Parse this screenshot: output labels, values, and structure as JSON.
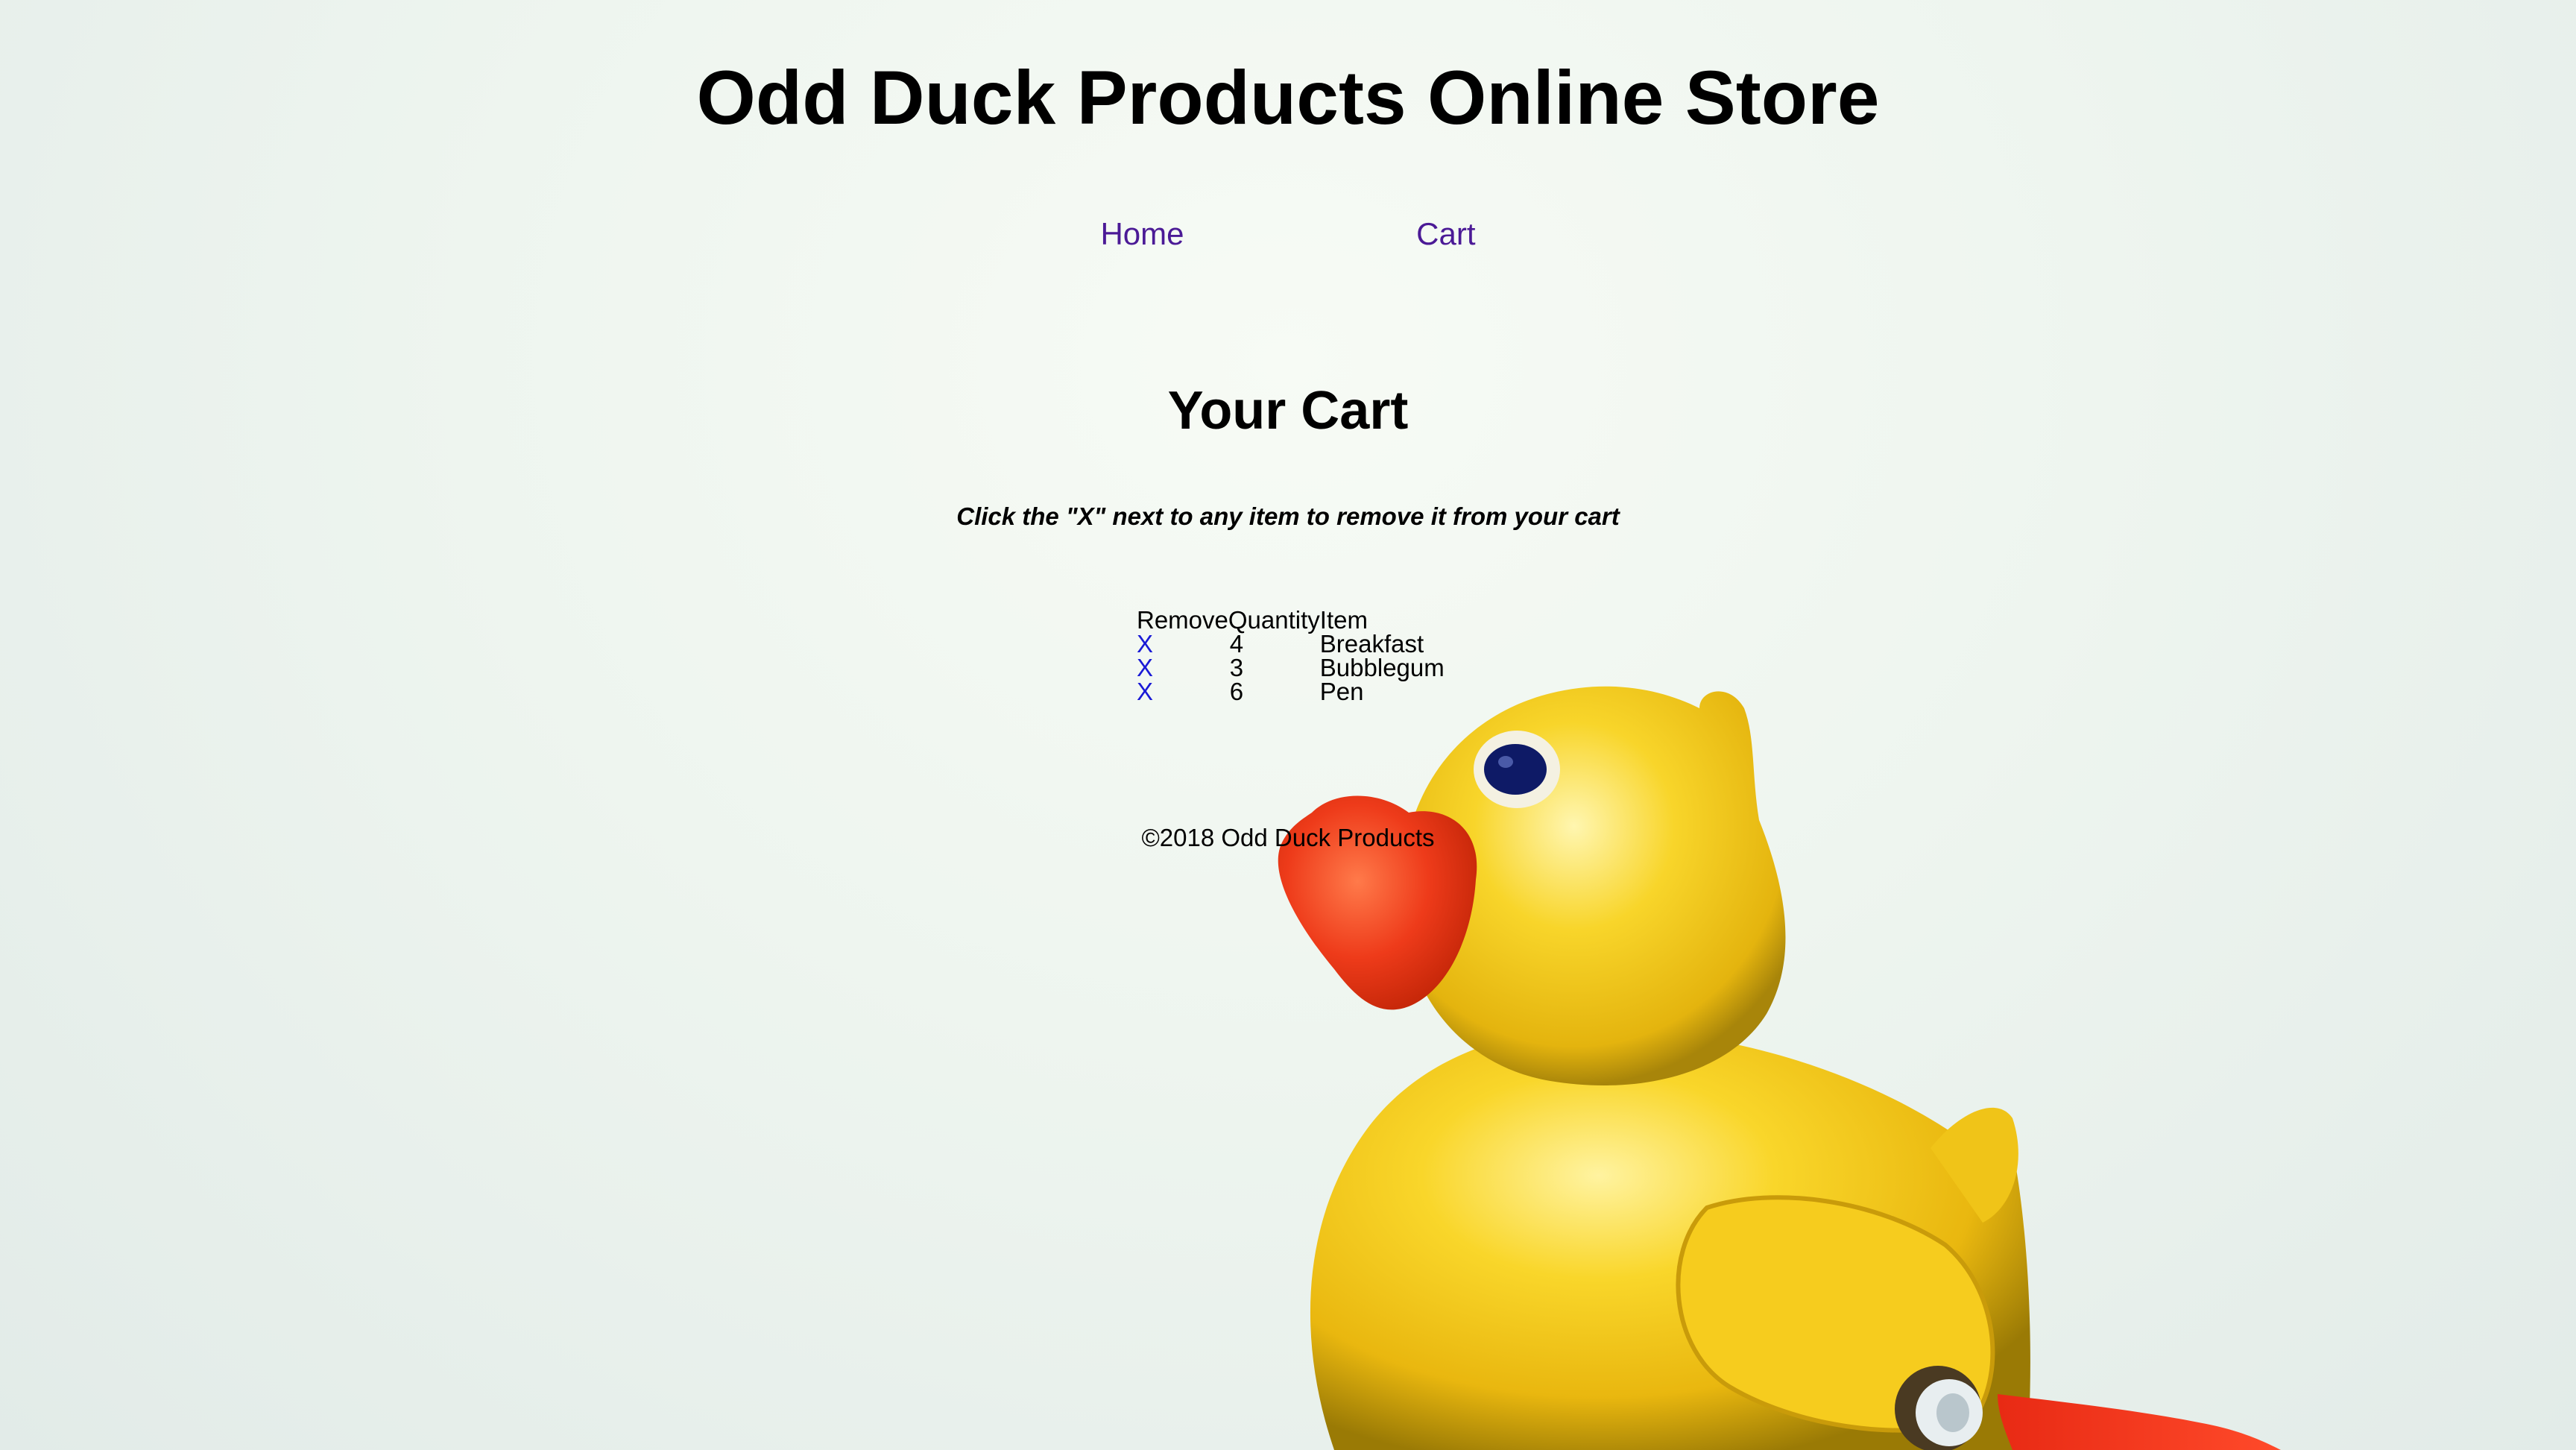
{
  "site": {
    "title": "Odd Duck Products Online Store"
  },
  "nav": {
    "home_label": "Home",
    "cart_label": "Cart",
    "link_color": "#4b1a96"
  },
  "cart": {
    "heading": "Your Cart",
    "instructions": "Click the \"X\" next to any item to remove it from your cart",
    "columns": [
      "Remove",
      "Quantity",
      "Item"
    ],
    "rows": [
      {
        "remove": "X",
        "quantity": "4",
        "item": "Breakfast"
      },
      {
        "remove": "X",
        "quantity": "3",
        "item": "Bubblegum"
      },
      {
        "remove": "X",
        "quantity": "6",
        "item": "Pen"
      }
    ],
    "remove_link_color": "#1a1ad6"
  },
  "footer": {
    "text": "©2018 Odd Duck Products"
  },
  "background": {
    "image": "yellow-rubber-duck-toy",
    "colors": {
      "body": "#f5c91a",
      "beak": "#ef3a1c",
      "eye": "#0e1a66"
    }
  }
}
